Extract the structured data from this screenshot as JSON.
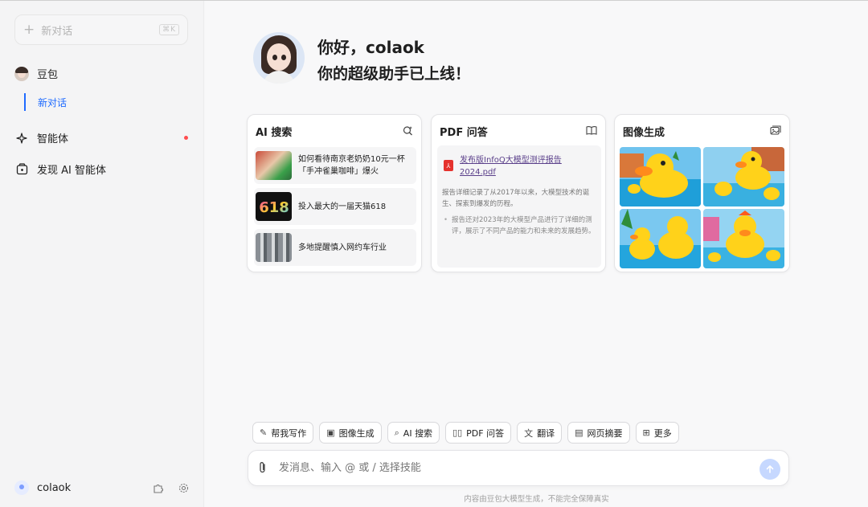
{
  "sidebar": {
    "new_chat": {
      "label": "新对话",
      "shortcut": "⌘K"
    },
    "bot": {
      "name": "豆包"
    },
    "sub_item": "新对话",
    "agents": "智能体",
    "discover": "发现 AI 智能体",
    "user": {
      "name": "colaok"
    },
    "notification_color": "#ff4d4f"
  },
  "main": {
    "greeting": "你好，colaok",
    "subtitle": "你的超级助手已上线！",
    "cards": {
      "search": {
        "title": "AI 搜索",
        "icon": "search-sparkle-icon",
        "items": [
          {
            "text": "如何看待南京老奶奶10元一杯「手冲雀巢咖啡」爆火"
          },
          {
            "text": "投入最大的一届天猫618"
          },
          {
            "text": "多地提醒慎入网约车行业"
          }
        ]
      },
      "pdf": {
        "title": "PDF 问答",
        "icon": "book-icon",
        "file": "发布版InfoQ大模型测评报告2024.pdf",
        "para": "报告详细记录了从2017年以来，大模型技术的诞生、探索到爆发的历程。",
        "bullet": "报告还对2023年的大模型产品进行了详细的测评，展示了不同产品的能力和未来的发展趋势。"
      },
      "image": {
        "title": "图像生成",
        "icon": "image-icon"
      }
    },
    "toolbar": [
      {
        "label": "帮我写作",
        "icon": "pen-icon"
      },
      {
        "label": "图像生成",
        "icon": "image-icon"
      },
      {
        "label": "AI 搜索",
        "icon": "search-icon"
      },
      {
        "label": "PDF 问答",
        "icon": "book-icon"
      },
      {
        "label": "翻译",
        "icon": "translate-icon"
      },
      {
        "label": "网页摘要",
        "icon": "document-icon"
      },
      {
        "label": "更多",
        "icon": "grid-icon"
      }
    ],
    "input": {
      "placeholder": "发消息、输入 @ 或 / 选择技能"
    },
    "footer": "内容由豆包大模型生成，不能完全保障真实",
    "accent": "#1f6bff"
  }
}
